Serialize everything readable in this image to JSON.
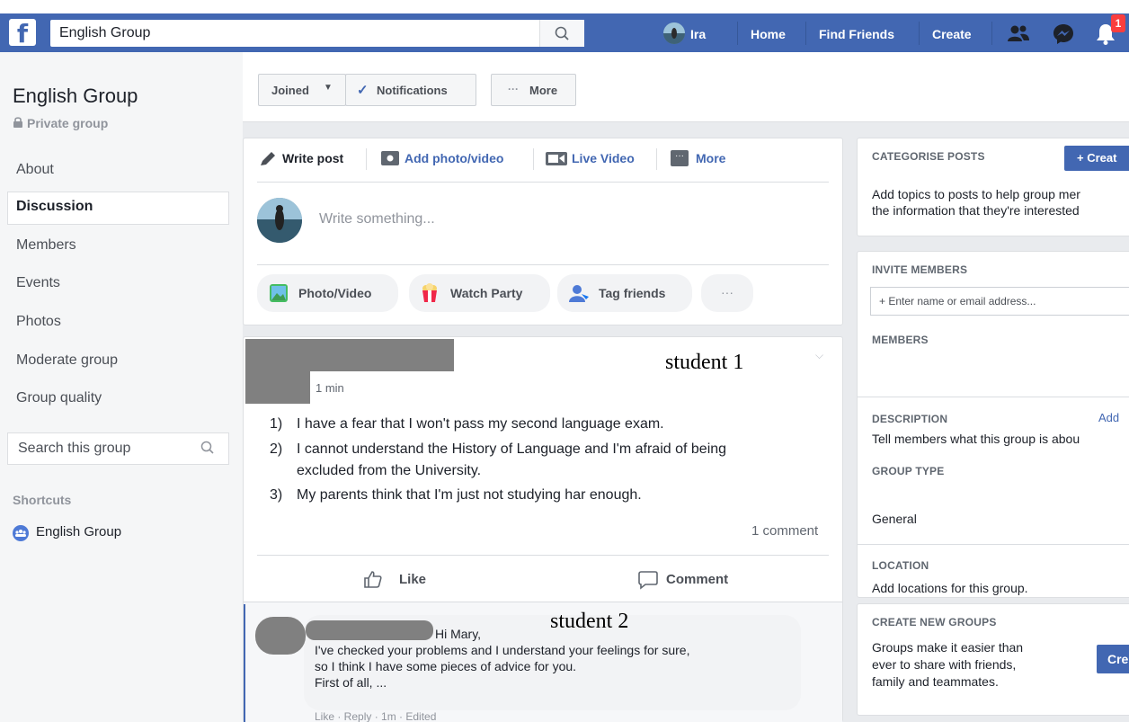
{
  "topbar": {
    "search_value": "English Group",
    "user_name": "Ira",
    "home": "Home",
    "find_friends": "Find Friends",
    "create": "Create",
    "notif_count": "1",
    "brand_color": "#4267b2"
  },
  "group_header": {
    "joined": "Joined",
    "notifications": "Notifications",
    "more": "More"
  },
  "sidebar": {
    "title": "English Group",
    "privacy": "Private group",
    "items": [
      "About",
      "Discussion",
      "Members",
      "Events",
      "Photos",
      "Moderate group",
      "Group quality"
    ],
    "active": "Discussion",
    "search_placeholder": "Search this group",
    "shortcuts_heading": "Shortcuts",
    "shortcut": "English Group"
  },
  "composer": {
    "write_post": "Write post",
    "add_photo": "Add photo/video",
    "live_video": "Live Video",
    "more": "More",
    "placeholder": "Write something...",
    "photo_video": "Photo/Video",
    "watch_party": "Watch Party",
    "tag_friends": "Tag friends"
  },
  "post": {
    "annotation": "student 1",
    "time": "1 min",
    "items": [
      {
        "num": "1)",
        "lines": [
          "I have a fear that I won't pass my second language exam."
        ]
      },
      {
        "num": "2)",
        "lines": [
          "I cannot understand the History of Language and I'm afraid of being",
          "excluded from the University."
        ]
      },
      {
        "num": "3)",
        "lines": [
          "My parents think that I'm just not studying har enough."
        ]
      }
    ],
    "comment_count": "1 comment",
    "like": "Like",
    "comment": "Comment"
  },
  "reply": {
    "annotation": "student 2",
    "lines": [
      "Hi Mary,",
      "I've checked your problems and I understand your feelings for sure,",
      "so I think I have some pieces of advice for you.",
      "First of all, ..."
    ],
    "actions": "Like · Reply · 1m · Edited"
  },
  "right": {
    "categorise_heading": "CATEGORISE POSTS",
    "create_btn": "+ Creat",
    "categorise_text": [
      "Add topics to posts to help group mer",
      "the information that they're interested"
    ],
    "invite_heading": "INVITE MEMBERS",
    "invite_placeholder": "+ Enter name or email address...",
    "members_heading": "MEMBERS",
    "description_heading": "DESCRIPTION",
    "add_link": "Add",
    "description_text": "Tell members what this group is abou",
    "group_type_heading": "GROUP TYPE",
    "group_type": "General",
    "location_heading": "LOCATION",
    "location_text": "Add locations for this group.",
    "create_groups_heading": "CREATE NEW GROUPS",
    "create_groups_text": [
      "Groups make it easier than",
      "ever to share with friends,",
      "family and teammates."
    ],
    "create_groups_btn": "Cre"
  }
}
